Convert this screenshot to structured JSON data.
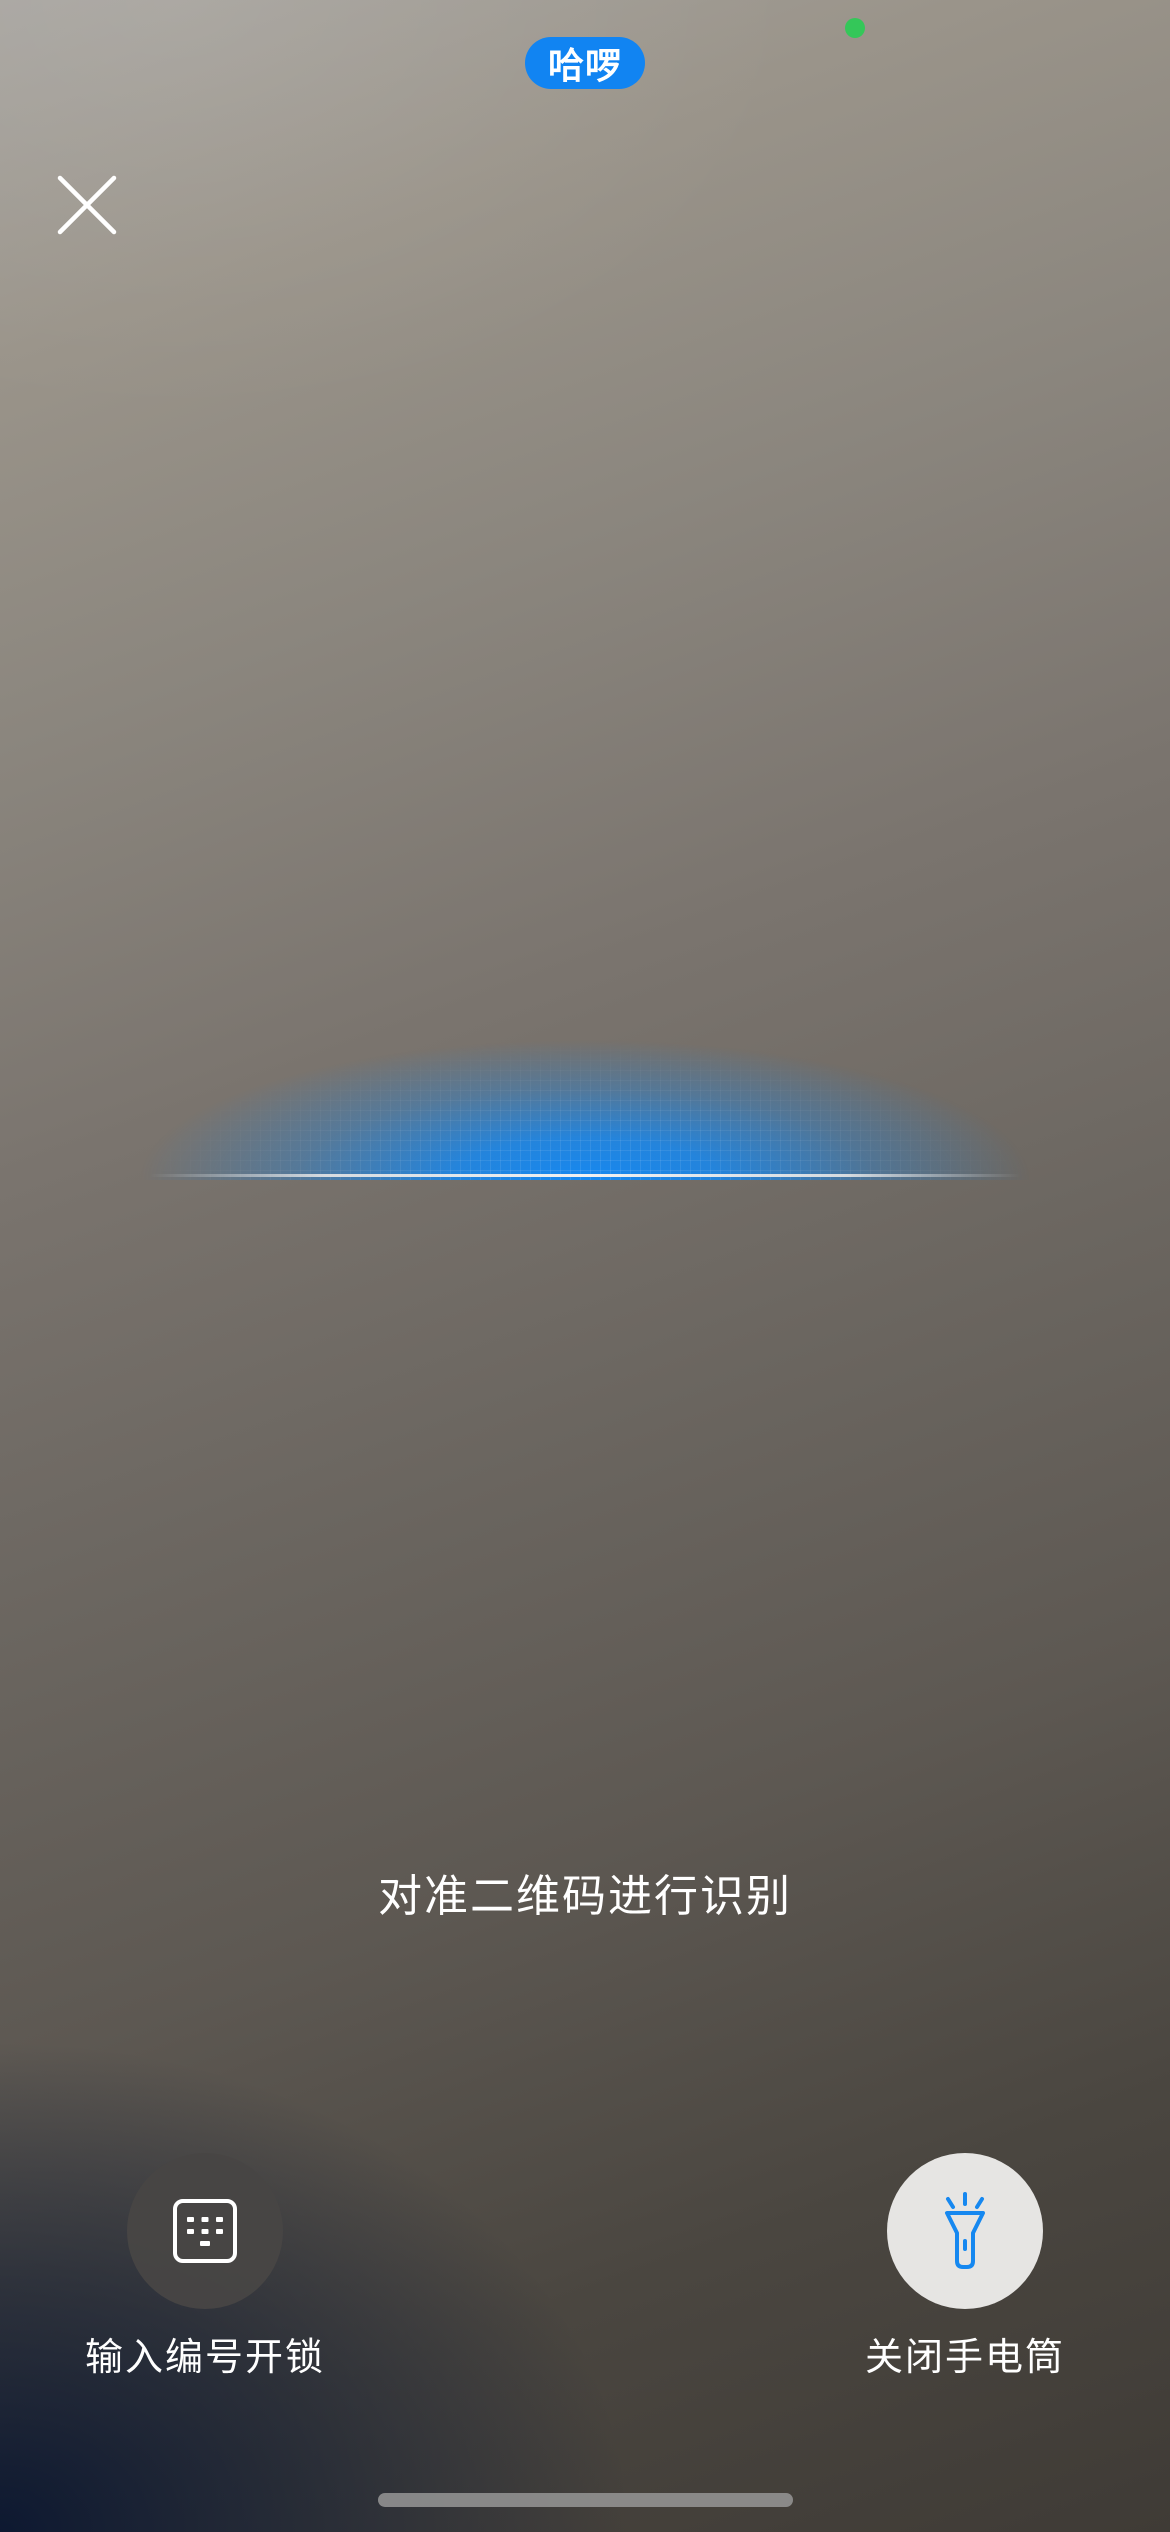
{
  "status": {
    "pill_text": "哈啰",
    "pill_color": "#1184f2",
    "indicator_color": "#34c759"
  },
  "header": {
    "close_icon": "close-icon"
  },
  "scanner": {
    "accent_color": "#1688f0",
    "hint": "对准二维码进行识别"
  },
  "actions": {
    "keypad": {
      "icon": "keypad-icon",
      "label": "输入编号开锁"
    },
    "torch": {
      "icon": "flashlight-icon",
      "label": "关闭手电筒",
      "icon_color": "#1688f0"
    }
  }
}
